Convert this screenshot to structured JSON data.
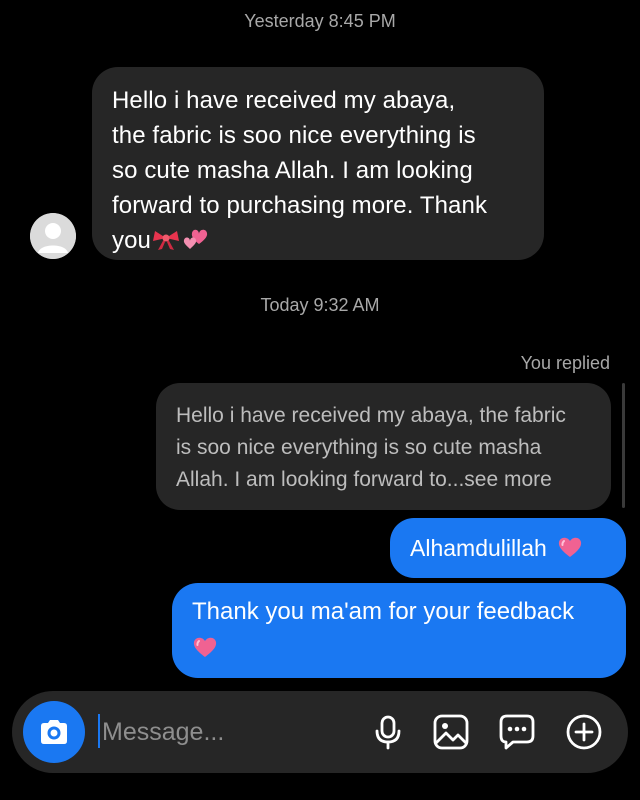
{
  "conversation": {
    "timestamp_1": "Yesterday 8:45 PM",
    "received_message": {
      "lines": [
        "Hello i have received my abaya,",
        "the fabric is soo nice everything is",
        "so cute masha Allah. I am looking",
        "forward to purchasing more. Thank",
        "you"
      ],
      "emojis": [
        "ribbon-emoji",
        "two-hearts-emoji"
      ]
    },
    "timestamp_2": "Today 9:32 AM",
    "you_replied": "You replied",
    "quoted_message": {
      "lines": [
        "Hello i have received my abaya, the fabric",
        "is soo nice everything is so cute masha",
        "Allah. I am looking forward to...see more"
      ]
    },
    "sent_messages": [
      {
        "text": "Alhamdulillah",
        "emoji": "pink-heart-emoji"
      },
      {
        "text": "Thank you ma'am for your feedback",
        "emoji": "pink-heart-emoji"
      }
    ]
  },
  "composer": {
    "placeholder": "Message...",
    "icons": [
      "camera-icon",
      "microphone-icon",
      "gallery-icon",
      "sticker-icon",
      "plus-icon"
    ]
  },
  "colors": {
    "background": "#000000",
    "received_bubble": "#262626",
    "sent_bubble": "#1a78f2",
    "meta_text": "#a8a8a8",
    "accent": "#1a78f2"
  }
}
